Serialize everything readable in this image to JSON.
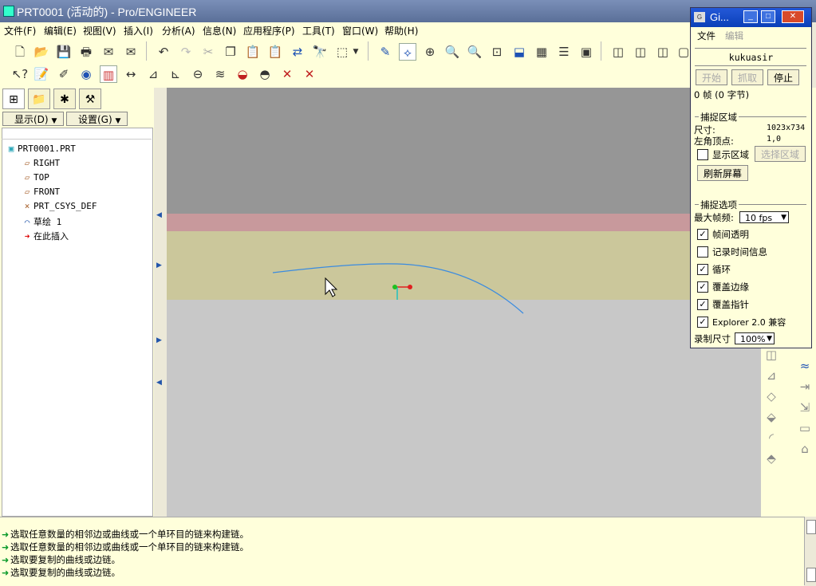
{
  "window": {
    "title": "PRT0001 (活动的) - Pro/ENGINEER"
  },
  "menubar": [
    "文件(F)",
    "编辑(E)",
    "视图(V)",
    "插入(I)",
    "分析(A)",
    "信息(N)",
    "应用程序(P)",
    "工具(T)",
    "窗口(W)",
    "帮助(H)"
  ],
  "panel": {
    "show_btn": "显示(D)",
    "settings_btn": "设置(G)",
    "tree": [
      {
        "label": "PRT0001.PRT",
        "icon": "part-icon"
      },
      {
        "label": "RIGHT",
        "icon": "datum-plane-icon"
      },
      {
        "label": "TOP",
        "icon": "datum-plane-icon"
      },
      {
        "label": "FRONT",
        "icon": "datum-plane-icon"
      },
      {
        "label": "PRT_CSYS_DEF",
        "icon": "csys-icon"
      },
      {
        "label": "草绘 1",
        "icon": "sketch-icon"
      },
      {
        "label": "在此插入",
        "icon": "insert-arrow-icon"
      }
    ]
  },
  "messages": [
    "选取任意数量的相邻边或曲线或一个单环目的链来构建链。",
    "选取任意数量的相邻边或曲线或一个单环目的链来构建链。",
    "选取要复制的曲线或边链。",
    "选取要复制的曲线或边链。"
  ],
  "capture": {
    "title": "Gi...",
    "menu": [
      "文件",
      "编辑"
    ],
    "name": "kukuasir",
    "buttons": {
      "start": "开始",
      "grab": "抓取",
      "stop": "停止"
    },
    "frames": "0 帧 (0 字节)",
    "region_group": "捕捉区域",
    "size_label": "尺寸:",
    "size_value": "1023x734",
    "corner_label": "左角顶点:",
    "corner_value": "1,0",
    "show_region": "显示区域",
    "select_region": "选择区域",
    "refresh": "刷新屏幕",
    "options_group": "捕捉选项",
    "max_fps_label": "最大帧频:",
    "max_fps_value": "10 fps",
    "options": [
      {
        "label": "帧间透明",
        "checked": true
      },
      {
        "label": "记录时间信息",
        "checked": false
      },
      {
        "label": "循环",
        "checked": true
      },
      {
        "label": "覆盖边缘",
        "checked": true
      },
      {
        "label": "覆盖指针",
        "checked": true
      },
      {
        "label": "Explorer 2.0 兼容",
        "checked": true
      }
    ],
    "record_size_label": "录制尺寸",
    "record_size_value": "100%"
  },
  "colors": {
    "curve": "#3a8be0",
    "csys_red": "#e02020",
    "csys_green": "#20c020",
    "csys_cyan": "#20c0c0"
  }
}
